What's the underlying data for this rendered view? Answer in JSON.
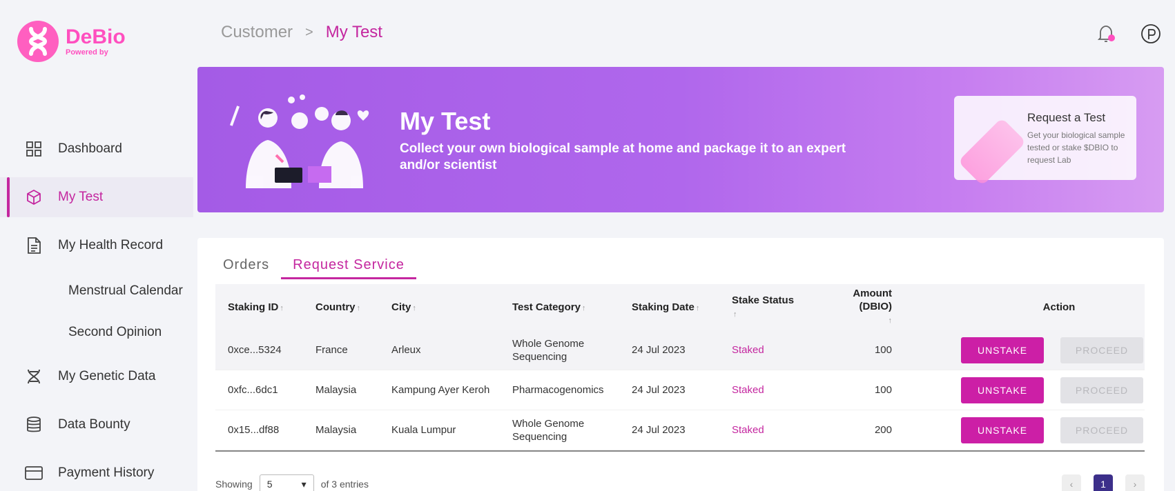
{
  "brand": {
    "name": "DeBio",
    "sub": "Powered by"
  },
  "breadcrumb": {
    "root": "Customer",
    "separator": ">",
    "current": "My Test"
  },
  "nav": {
    "dashboard": "Dashboard",
    "my_test": "My Test",
    "health_record": "My Health Record",
    "menstrual": "Menstrual Calendar",
    "second_opinion": "Second Opinion",
    "genetic": "My Genetic Data",
    "bounty": "Data Bounty",
    "payment": "Payment History"
  },
  "banner": {
    "title": "My Test",
    "description": "Collect your own biological sample at home and package it to an expert and/or scientist",
    "card_title": "Request a Test",
    "card_desc": "Get your biological sample tested or stake $DBIO to request Lab"
  },
  "tabs": {
    "orders": "Orders",
    "request": "Request Service"
  },
  "table": {
    "headers": {
      "staking_id": "Staking ID",
      "country": "Country",
      "city": "City",
      "category": "Test Category",
      "date": "Staking Date",
      "status": "Stake Status",
      "amount": "Amount (DBIO)",
      "action": "Action"
    },
    "rows": [
      {
        "id": "0xce...5324",
        "country": "France",
        "city": "Arleux",
        "category": "Whole Genome Sequencing",
        "date": "24 Jul 2023",
        "status": "Staked",
        "amount": "100",
        "unstake": "UNSTAKE",
        "proceed": "PROCEED"
      },
      {
        "id": "0xfc...6dc1",
        "country": "Malaysia",
        "city": "Kampung Ayer Keroh",
        "category": "Pharmacogenomics",
        "date": "24 Jul 2023",
        "status": "Staked",
        "amount": "100",
        "unstake": "UNSTAKE",
        "proceed": "PROCEED"
      },
      {
        "id": "0x15...df88",
        "country": "Malaysia",
        "city": "Kuala Lumpur",
        "category": "Whole Genome Sequencing",
        "date": "24 Jul 2023",
        "status": "Staked",
        "amount": "200",
        "unstake": "UNSTAKE",
        "proceed": "PROCEED"
      }
    ]
  },
  "footer": {
    "showing": "Showing",
    "page_size": "5",
    "entries": "of 3 entries",
    "current_page": "1"
  },
  "colors": {
    "accent": "#c4269f",
    "banner": "#a45be6",
    "brand": "#ff4fbf",
    "page_active": "#3c2f8a"
  }
}
